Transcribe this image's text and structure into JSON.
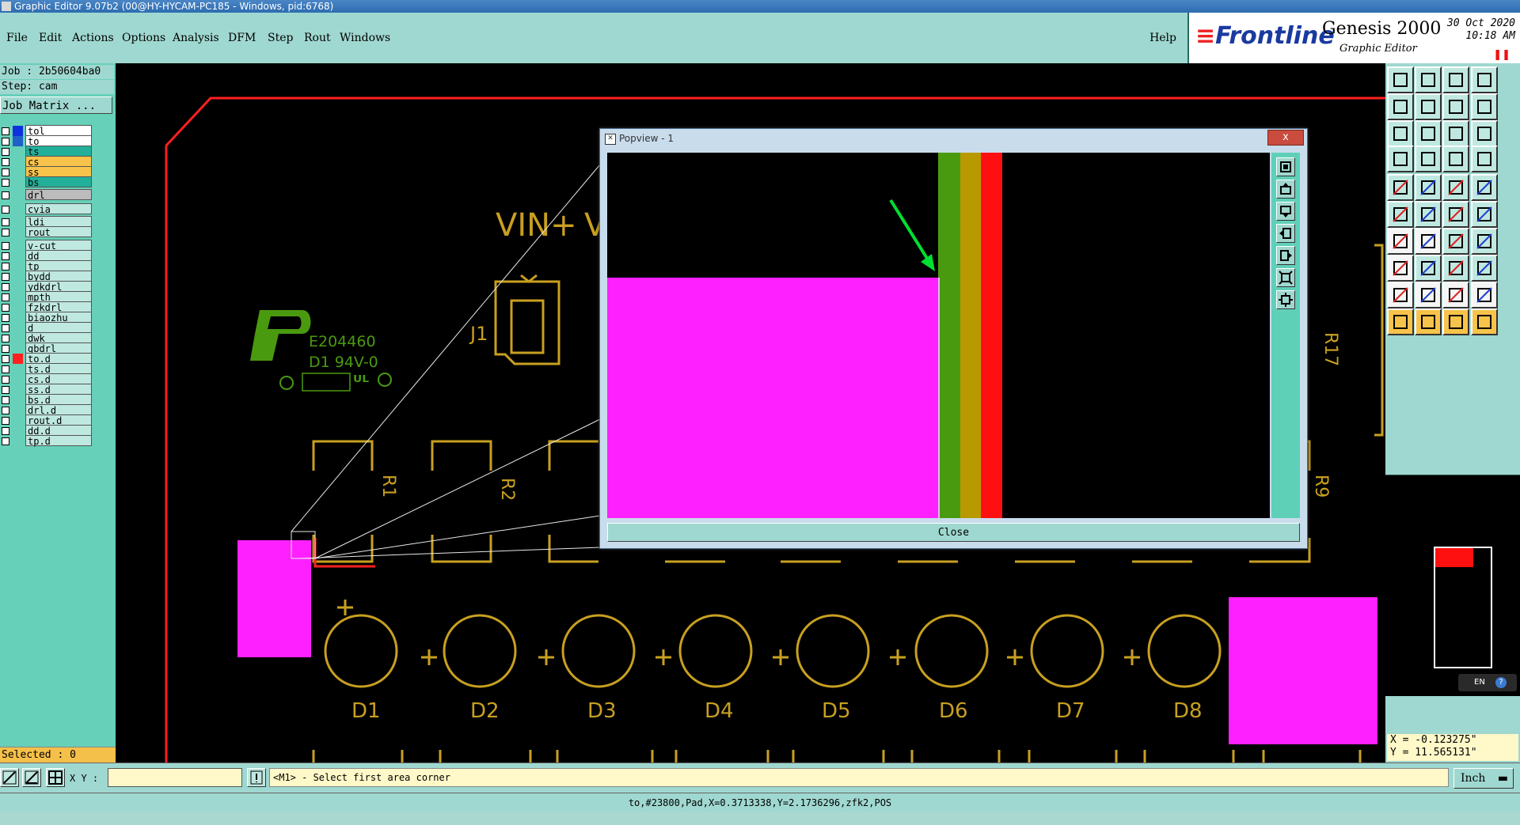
{
  "window": {
    "title": "Graphic Editor 9.07b2 (00@HY-HYCAM-PC185 - Windows, pid:6768)"
  },
  "menu": {
    "items": [
      "File",
      "Edit",
      "Actions",
      "Options",
      "Analysis",
      "DFM",
      "Step",
      "Rout",
      "Windows"
    ],
    "help": "Help"
  },
  "logo": {
    "brand": "Frontline",
    "product": "Genesis 2000",
    "subtitle": "Graphic Editor",
    "date": "30 Oct 2020",
    "time": "10:18 AM",
    "pause_icon": "pause-icon"
  },
  "left": {
    "job": "Job : 2b50604ba0",
    "step": "Step: cam",
    "job_matrix": "Job Matrix ...",
    "layers": [
      {
        "name": "tol",
        "swatch": "#1030e0"
      },
      {
        "name": "to",
        "swatch": "#2060c8"
      },
      {
        "name": "ts",
        "swatch": ""
      },
      {
        "name": "cs",
        "swatch": ""
      },
      {
        "name": "ss",
        "swatch": ""
      },
      {
        "name": "bs",
        "swatch": ""
      },
      {
        "name": "drl",
        "swatch": ""
      },
      {
        "name": "cvia",
        "swatch": ""
      },
      {
        "name": "ldi",
        "swatch": ""
      },
      {
        "name": "rout",
        "swatch": ""
      },
      {
        "name": "v-cut",
        "swatch": ""
      },
      {
        "name": "dd",
        "swatch": ""
      },
      {
        "name": "tp",
        "swatch": ""
      },
      {
        "name": "bydd",
        "swatch": ""
      },
      {
        "name": "ydkdrl",
        "swatch": ""
      },
      {
        "name": "mpth",
        "swatch": ""
      },
      {
        "name": "fzkdrl",
        "swatch": ""
      },
      {
        "name": "biaozhu",
        "swatch": ""
      },
      {
        "name": "d",
        "swatch": ""
      },
      {
        "name": "dwk",
        "swatch": ""
      },
      {
        "name": "gbdrl",
        "swatch": ""
      },
      {
        "name": "to.d",
        "swatch": "#ff2020"
      },
      {
        "name": "ts.d",
        "swatch": ""
      },
      {
        "name": "cs.d",
        "swatch": ""
      },
      {
        "name": "ss.d",
        "swatch": ""
      },
      {
        "name": "bs.d",
        "swatch": ""
      },
      {
        "name": "drl.d",
        "swatch": ""
      },
      {
        "name": "rout.d",
        "swatch": ""
      },
      {
        "name": "dd.d",
        "swatch": ""
      },
      {
        "name": "tp.d",
        "swatch": ""
      }
    ],
    "selected": "Selected : 0"
  },
  "board": {
    "silk_labels": {
      "vin": "VIN+",
      "v": "V",
      "j1": "J1",
      "r17": "R17",
      "r9": "R9",
      "r1": "R1",
      "r2": "R2"
    },
    "ul_mark": {
      "line1": "E204460",
      "line2": "D1  94V-0"
    },
    "diodes": [
      "D1",
      "D2",
      "D3",
      "D4",
      "D5",
      "D6",
      "D7",
      "D8"
    ]
  },
  "popview": {
    "title": "Popview - 1",
    "close": "Close",
    "close_glyph": "x"
  },
  "bottom": {
    "xy_label": "X Y :",
    "xy_value": "",
    "message": "<M1> - Select first area corner",
    "unit": "Inch",
    "status": "to,#23800,Pad,X=0.3713338,Y=2.1736296,zfk2,POS"
  },
  "coords": {
    "x": "X = -0.123275\"",
    "y": "Y = 11.565131\""
  },
  "lang": "EN",
  "colors": {
    "copper": "#c8a020",
    "magenta": "#ff20ff",
    "green": "#4a9a10",
    "red": "#ff1010",
    "panel": "#9fd8d0",
    "layer_active": "#22b09a",
    "layer_sel": "#f7c34a"
  }
}
